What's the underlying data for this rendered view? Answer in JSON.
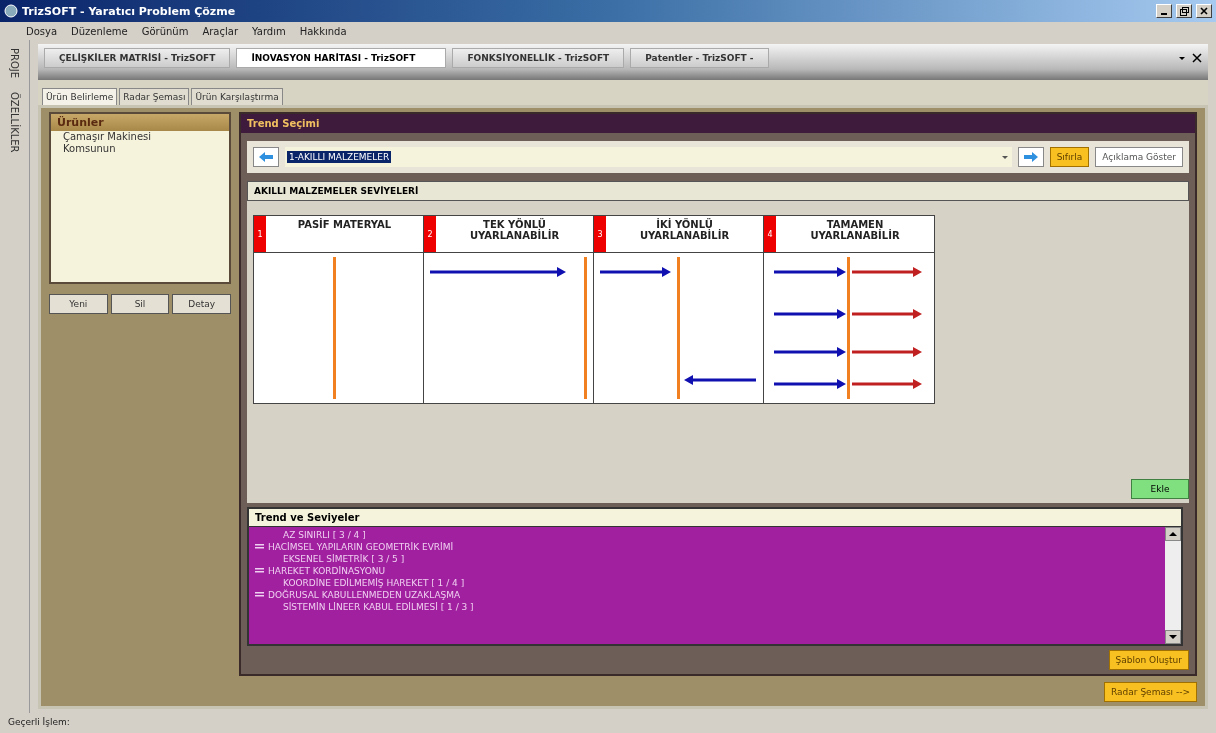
{
  "window": {
    "title": "TrizSOFT - Yaratıcı Problem Çözme"
  },
  "menu": [
    "Dosya",
    "Düzenleme",
    "Görünüm",
    "Araçlar",
    "Yardım",
    "Hakkında"
  ],
  "side_strip": [
    "PROJE",
    "ÖZELLİKLER"
  ],
  "doc_tabs": [
    {
      "label": "ÇELİŞKİLER MATRİSİ - TrizSOFT",
      "selected": false
    },
    {
      "label": "İNOVASYON HARİTASI - TrizSOFT",
      "selected": true
    },
    {
      "label": "FONKSİYONELLİK - TrizSOFT",
      "selected": false
    },
    {
      "label": "Patentler - TrizSOFT -",
      "selected": false
    }
  ],
  "sub_tabs": [
    {
      "label": "Ürün Belirleme",
      "selected": true
    },
    {
      "label": "Radar Şeması",
      "selected": false
    },
    {
      "label": "Ürün Karşılaştırma",
      "selected": false
    }
  ],
  "products": {
    "title": "Ürünler",
    "items": [
      "Çamaşır Makinesi",
      "Komsunun"
    ],
    "buttons": [
      "Yeni",
      "Sil",
      "Detay"
    ]
  },
  "trend_selection": {
    "title": "Trend Seçimi",
    "value": "1-AKILLI MALZEMELER",
    "reset": "Sıfırla",
    "describe": "Açıklama Göster"
  },
  "levels": {
    "title": "AKILLI MALZEMELER SEVİYELERİ",
    "cards": [
      {
        "number": "1",
        "title": "PASİF MATERYAL",
        "kind": "passive"
      },
      {
        "number": "2",
        "title": "TEK YÖNLÜ UYARLANABİLİR",
        "kind": "oneway"
      },
      {
        "number": "3",
        "title": "İKİ YÖNLÜ UYARLANABİLİR",
        "kind": "twoway"
      },
      {
        "number": "4",
        "title": "TAMAMEN UYARLANABİLİR",
        "kind": "full"
      }
    ],
    "add": "Ekle"
  },
  "trends": {
    "title": "Trend ve Seviyeler",
    "items": [
      {
        "children": [
          {
            "label": "AZ SINIRLI [ 3 / 4 ]"
          }
        ]
      },
      {
        "label": "HACİMSEL YAPILARIN GEOMETRİK EVRİMİ",
        "expanded": true,
        "children": [
          {
            "label": "EKSENEL SİMETRİK [ 3 / 5 ]"
          }
        ]
      },
      {
        "label": "HAREKET KORDİNASYONU",
        "expanded": true,
        "children": [
          {
            "label": "KOORDİNE EDİLMEMİŞ HAREKET [ 1 / 4 ]"
          }
        ]
      },
      {
        "label": "DOĞRUSAL KABULLENMEDEN UZAKLAŞMA",
        "expanded": true,
        "children": [
          {
            "label": "SİSTEMİN LİNEER KABUL EDİLMESİ [ 1 / 3 ]"
          }
        ]
      }
    ],
    "template": "Şablon Oluştur"
  },
  "radar_button": "Radar Şeması -->",
  "status_bar": "Geçerli İşlem:"
}
